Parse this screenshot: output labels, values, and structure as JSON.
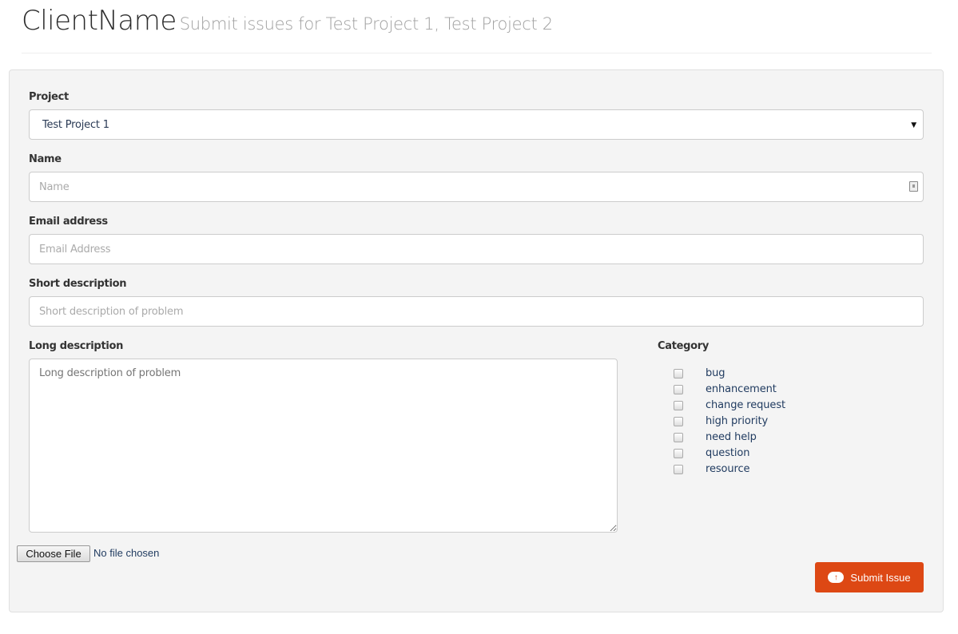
{
  "header": {
    "title": "ClientName",
    "subtitle": "Submit issues for Test Project 1, Test Project 2"
  },
  "form": {
    "project": {
      "label": "Project",
      "value": "Test Project 1"
    },
    "name": {
      "label": "Name",
      "placeholder": "Name"
    },
    "email": {
      "label": "Email address",
      "placeholder": "Email Address"
    },
    "short": {
      "label": "Short description",
      "placeholder": "Short description of problem"
    },
    "long": {
      "label": "Long description",
      "placeholder": "Long description of problem"
    },
    "category": {
      "label": "Category",
      "items": [
        "bug",
        "enhancement",
        "change request",
        "high priority",
        "need help",
        "question",
        "resource"
      ]
    },
    "file": {
      "button": "Choose File",
      "status": "No file chosen"
    },
    "submit": {
      "label": "Submit Issue",
      "icon": "cloud-upload-icon",
      "color": "#dd4814"
    }
  }
}
